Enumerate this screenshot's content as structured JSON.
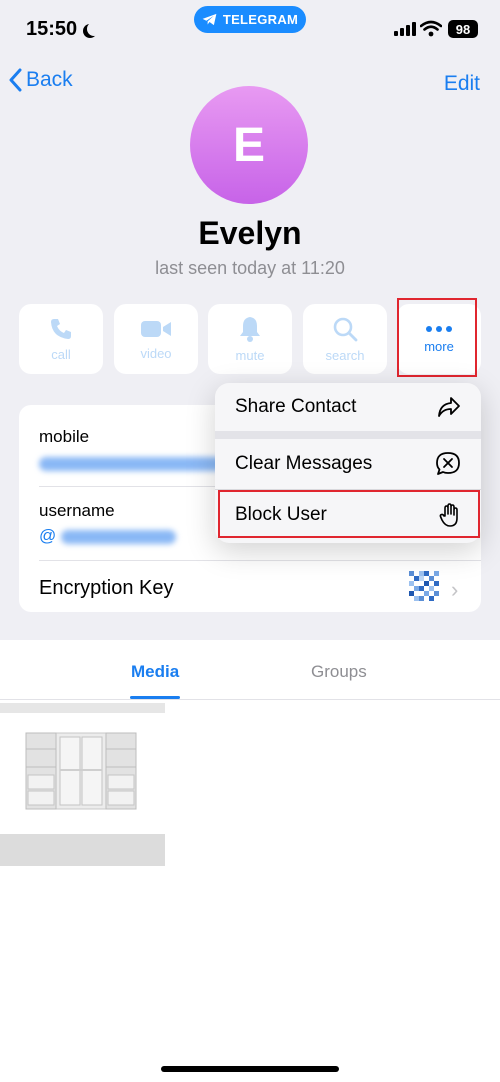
{
  "status_bar": {
    "time": "15:50",
    "app_pill": "TELEGRAM",
    "battery": "98"
  },
  "nav": {
    "back_label": "Back",
    "edit_label": "Edit"
  },
  "profile": {
    "avatar_letter": "E",
    "name": "Evelyn",
    "last_seen": "last seen today at 11:20"
  },
  "actions": [
    {
      "label": "call",
      "icon": "phone-icon"
    },
    {
      "label": "video",
      "icon": "video-icon"
    },
    {
      "label": "mute",
      "icon": "bell-icon"
    },
    {
      "label": "search",
      "icon": "search-icon"
    },
    {
      "label": "more",
      "icon": "ellipsis-icon"
    }
  ],
  "info": {
    "mobile_label": "mobile",
    "username_label": "username",
    "username_prefix": "@",
    "encryption_label": "Encryption Key"
  },
  "menu": {
    "share_contact": "Share Contact",
    "clear_messages": "Clear Messages",
    "block_user": "Block User"
  },
  "tabs": {
    "media": "Media",
    "groups": "Groups"
  },
  "colors": {
    "accent": "#1a7ef0",
    "highlight": "#e0262f",
    "avatar_top": "#e89af2",
    "avatar_bottom": "#c763e8"
  }
}
